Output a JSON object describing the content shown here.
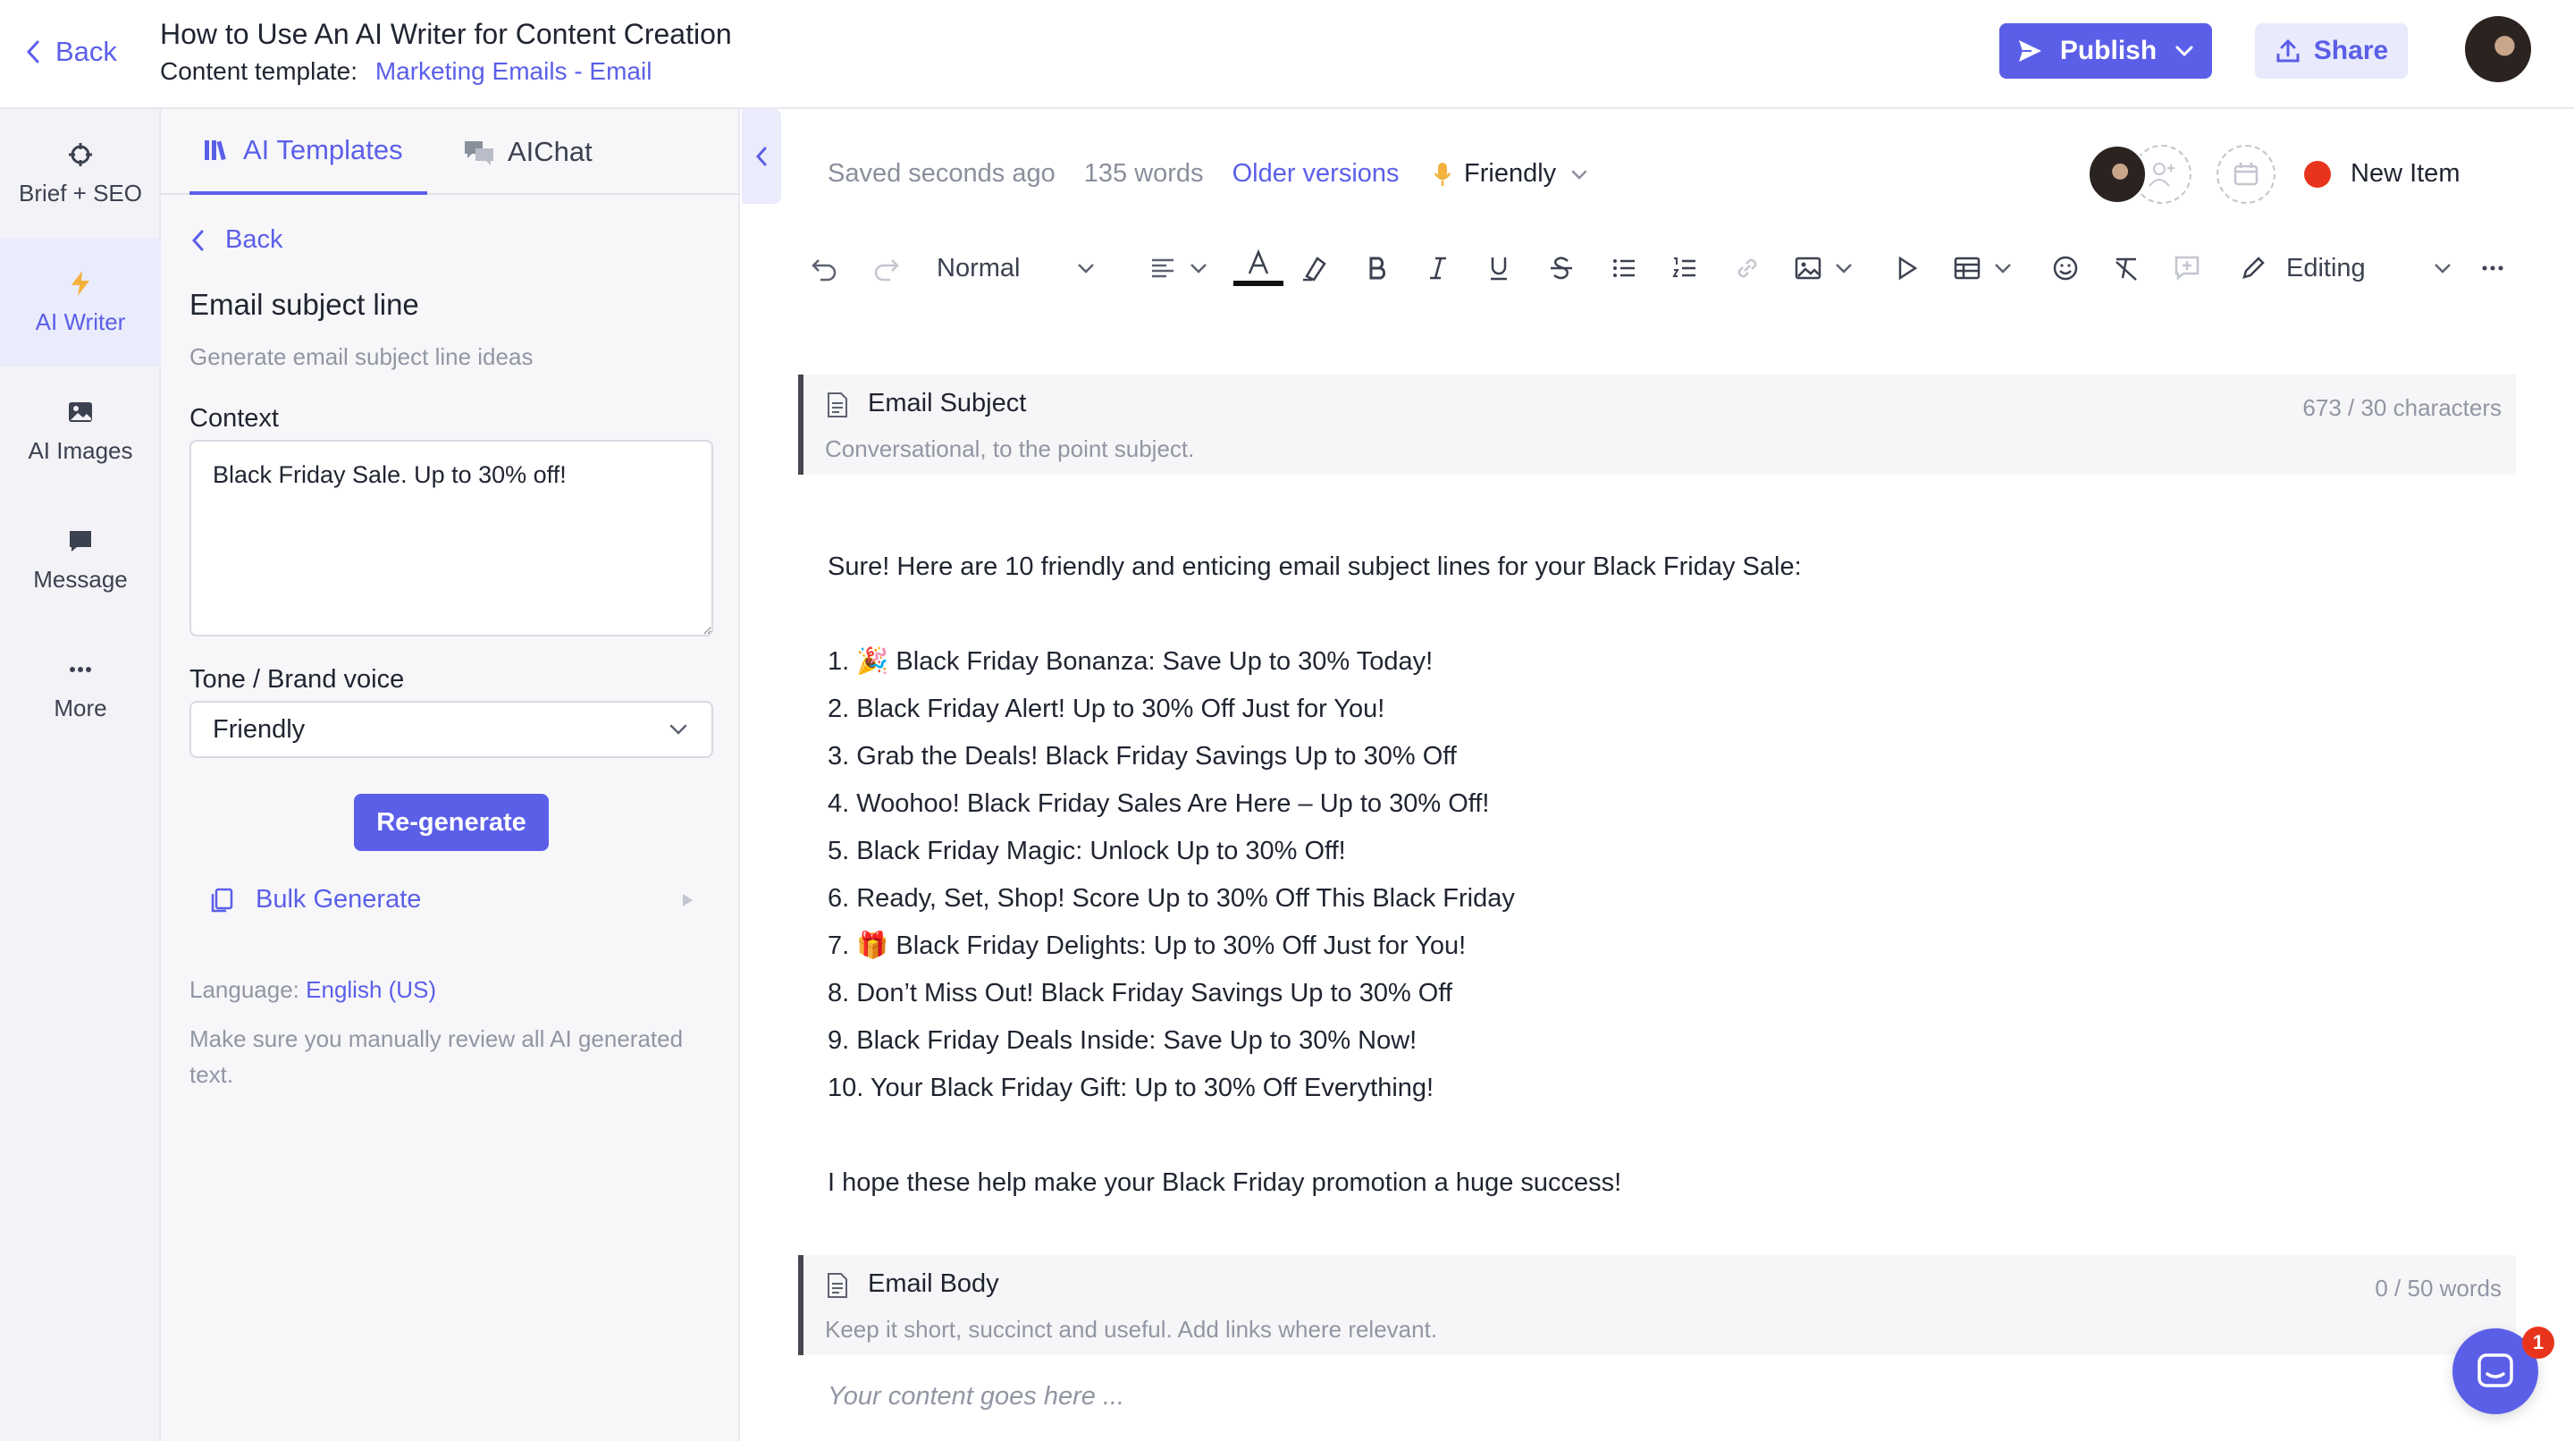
{
  "header": {
    "back_label": "Back",
    "title": "How to Use An AI Writer for Content Creation",
    "template_label": "Content template:",
    "template_value": "Marketing Emails - Email",
    "publish_label": "Publish",
    "share_label": "Share"
  },
  "rail": {
    "items": [
      {
        "label": "Brief + SEO",
        "icon": "crosshair-icon"
      },
      {
        "label": "AI Writer",
        "icon": "lightning-icon"
      },
      {
        "label": "AI Images",
        "icon": "image-icon"
      },
      {
        "label": "Message",
        "icon": "message-icon"
      },
      {
        "label": "More",
        "icon": "more-icon"
      }
    ],
    "active_index": 1
  },
  "panel": {
    "tabs": [
      {
        "label": "AI Templates",
        "icon": "library-icon"
      },
      {
        "label": "AIChat",
        "icon": "chat-bubbles-icon"
      }
    ],
    "back_label": "Back",
    "template_title": "Email subject line",
    "template_subtitle": "Generate email subject line ideas",
    "context_label": "Context",
    "context_value": "Black Friday Sale. Up to 30% off!",
    "tone_label": "Tone / Brand voice",
    "tone_value": "Friendly",
    "regenerate_label": "Re-generate",
    "bulk_label": "Bulk Generate",
    "language_label": "Language:",
    "language_value": "English (US)",
    "review_note": "Make sure you manually review all AI generated text."
  },
  "editor": {
    "saved_status": "Saved seconds ago",
    "word_count": "135 words",
    "older_versions": "Older versions",
    "tone": "Friendly",
    "new_item": "New Item",
    "toolbar": {
      "style": "Normal",
      "mode": "Editing"
    },
    "blocks": [
      {
        "title": "Email Subject",
        "subtitle": "Conversational, to the point subject.",
        "count": "673 / 30 characters"
      },
      {
        "title": "Email Body",
        "subtitle": "Keep it short, succinct and useful. Add links where relevant.",
        "count": "0 / 50 words"
      }
    ],
    "content": {
      "intro": "Sure! Here are 10 friendly and enticing email subject lines for your Black Friday Sale:",
      "lines": [
        "1. 🎉 Black Friday Bonanza: Save Up to 30% Today!",
        "2. Black Friday Alert! Up to 30% Off Just for You!",
        "3. Grab the Deals! Black Friday Savings Up to 30% Off",
        "4. Woohoo! Black Friday Sales Are Here – Up to 30% Off!",
        "5. Black Friday Magic: Unlock Up to 30% Off!",
        "6. Ready, Set, Shop! Score Up to 30% Off This Black Friday",
        "7. 🎁 Black Friday Delights: Up to 30% Off Just for You!",
        "8. Don’t Miss Out! Black Friday Savings Up to 30% Off",
        "9. Black Friday Deals Inside: Save Up to 30% Now!",
        "10. Your Black Friday Gift: Up to 30% Off Everything!"
      ],
      "outro": "I hope these help make your Black Friday promotion a huge success!"
    },
    "body_placeholder": "Your content goes here ..."
  },
  "chat": {
    "badge_count": "1"
  },
  "colors": {
    "accent": "#5b5fe8",
    "status_red": "#e8341c"
  }
}
